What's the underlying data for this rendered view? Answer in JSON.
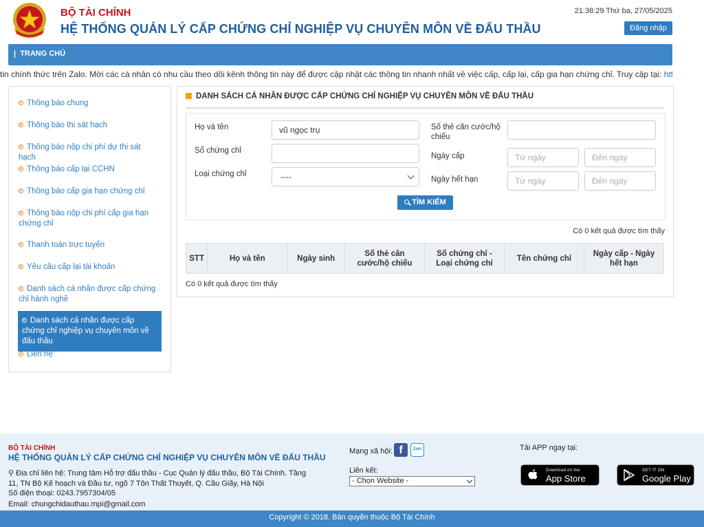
{
  "header": {
    "org": "BỘ TÀI CHÍNH",
    "system_title": "HỆ THỐNG QUẢN LÝ CẤP CHỨNG CHỈ NGHIỆP VỤ CHUYÊN MÔN VỀ ĐẤU THẦU",
    "datetime": "21:38:29 Thứ ba, 27/05/2025",
    "login_label": "Đăng nhập"
  },
  "nav": {
    "home": "TRANG CHỦ"
  },
  "marquee": {
    "text": "tin chính thức trên Zalo. Mời các cá nhân có nhu cầu theo dõi kênh thông tin này để được cập nhật các thông tin nhanh nhất về việc cấp, cấp lại, cấp gia hạn chứng chỉ. Truy cập tại: ",
    "link": "https://z"
  },
  "sidebar": {
    "items": [
      {
        "label": "Thông báo chung"
      },
      {
        "label": "Thông báo thi sát hạch"
      },
      {
        "label": "Thông báo nộp chi phí dự thi sát hạch"
      },
      {
        "label": "Thông báo cấp lại CCHN"
      },
      {
        "label": "Thông báo cấp gia hạn chứng chỉ"
      },
      {
        "label": "Thông báo nộp chi phí cấp gia hạn chứng chỉ"
      },
      {
        "label": "Thanh toán trực tuyến"
      },
      {
        "label": "Yêu cầu cấp lại tài khoản"
      },
      {
        "label": "Danh sách cá nhân được cấp chứng chỉ hành nghề"
      },
      {
        "label": "Danh sách cá nhân được cấp chứng chỉ nghiệp vụ chuyên môn về đấu thầu",
        "active": true
      },
      {
        "label": "Liên hệ"
      }
    ]
  },
  "main": {
    "title": "DANH SÁCH CÁ NHÂN ĐƯỢC CẤP CHỨNG CHỈ NGHIỆP VỤ CHUYÊN MÔN VỀ ĐẤU THẦU",
    "form": {
      "name_label": "Họ và tên",
      "name_value": "vũ ngọc trụ",
      "cert_no_label": "Số chứng chỉ",
      "cert_no_value": "",
      "cert_type_label": "Loại chứng chỉ",
      "cert_type_value": "----",
      "id_label": "Số thẻ căn cước/hộ chiếu",
      "id_value": "",
      "issue_date_label": "Ngày cấp",
      "expiry_label": "Ngày hết hạn",
      "from_placeholder": "Từ ngày",
      "to_placeholder": "Đến ngày",
      "search_label": "TÌM KIẾM"
    },
    "result_count": "Có 0 kết quả được tìm thấy",
    "table": {
      "columns": [
        "STT",
        "Họ và tên",
        "Ngày sinh",
        "Số thẻ căn cước/hộ chiếu",
        "Số chứng chỉ - Loại chứng chỉ",
        "Tên chứng chỉ",
        "Ngày cấp - Ngày hết hạn"
      ]
    }
  },
  "footer": {
    "org": "BỘ TÀI CHÍNH",
    "system_title": "HỆ THỐNG QUẢN LÝ CẤP CHỨNG CHỈ NGHIỆP VỤ CHUYÊN MÔN VỀ ĐẤU THẦU",
    "address": "Địa chỉ liên hệ: Trung tâm Hỗ trợ đấu thầu - Cục Quản lý đấu thầu, Bộ Tài Chính. Tầng 11, TN Bộ Kế hoạch và Đầu tư, ngõ 7 Tôn Thất Thuyết, Q. Cầu Giấy, Hà Nội",
    "phone": "Số điện thoại: 0243.7957304/05",
    "email": "Email: chungchidauthau.mpi@gmail.com",
    "social_label": "Mạng xã hội:",
    "zalo_text": "Zalo",
    "links_label": "Liên kết:",
    "links_select": "- Chọn Website -",
    "app_label": "Tải APP ngay tại:",
    "app_store_small": "Download on the",
    "app_store_big": "App Store",
    "google_small": "GET IT ON",
    "google_big": "Google Play",
    "copyright": "Copyright © 2018. Bản quyền thuộc Bộ Tài Chính"
  }
}
